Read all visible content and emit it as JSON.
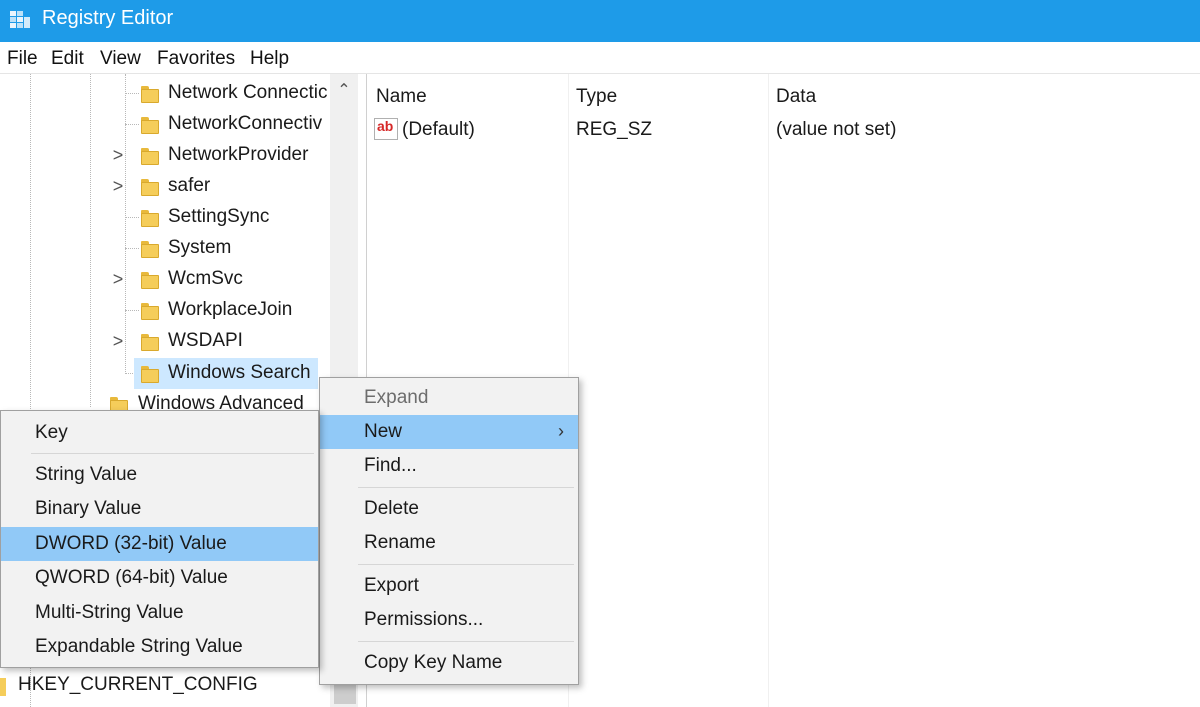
{
  "window": {
    "title": "Registry Editor"
  },
  "menubar": [
    "File",
    "Edit",
    "View",
    "Favorites",
    "Help"
  ],
  "tree": {
    "items": [
      {
        "label": "Network Connectic",
        "expandable": false
      },
      {
        "label": "NetworkConnectiv",
        "expandable": false
      },
      {
        "label": "NetworkProvider",
        "expandable": true
      },
      {
        "label": "safer",
        "expandable": true
      },
      {
        "label": "SettingSync",
        "expandable": false
      },
      {
        "label": "System",
        "expandable": false
      },
      {
        "label": "WcmSvc",
        "expandable": true
      },
      {
        "label": "WorkplaceJoin",
        "expandable": false
      },
      {
        "label": "WSDAPI",
        "expandable": true
      },
      {
        "label": "Windows Search",
        "expandable": false,
        "selected": true
      }
    ],
    "partial_item": "Windows Advanced",
    "bottom_item": "HKEY_CURRENT_CONFIG",
    "expander_glyph": ">"
  },
  "values_pane": {
    "columns": {
      "name": "Name",
      "type": "Type",
      "data": "Data"
    },
    "rows": [
      {
        "icon": "string-value-icon",
        "name": "(Default)",
        "type": "REG_SZ",
        "data": "(value not set)"
      }
    ],
    "icon_text": "ab"
  },
  "context_menu": {
    "items": [
      {
        "label": "Expand",
        "disabled": true
      },
      {
        "label": "New",
        "submenu": true,
        "active": true
      },
      {
        "label": "Find..."
      },
      {
        "label": "Delete"
      },
      {
        "label": "Rename"
      },
      {
        "label": "Export"
      },
      {
        "label": "Permissions..."
      },
      {
        "label": "Copy Key Name"
      }
    ],
    "submenu_glyph": "›"
  },
  "new_submenu": {
    "items": [
      {
        "label": "Key"
      },
      {
        "label": "String Value"
      },
      {
        "label": "Binary Value"
      },
      {
        "label": "DWORD (32-bit) Value",
        "active": true
      },
      {
        "label": "QWORD (64-bit) Value"
      },
      {
        "label": "Multi-String Value"
      },
      {
        "label": "Expandable String Value"
      }
    ]
  },
  "colors": {
    "titlebar": "#1e9be8",
    "menu_highlight": "#91c9f7",
    "tree_selection": "#cde8ff",
    "folder": "#f5cd5a"
  }
}
